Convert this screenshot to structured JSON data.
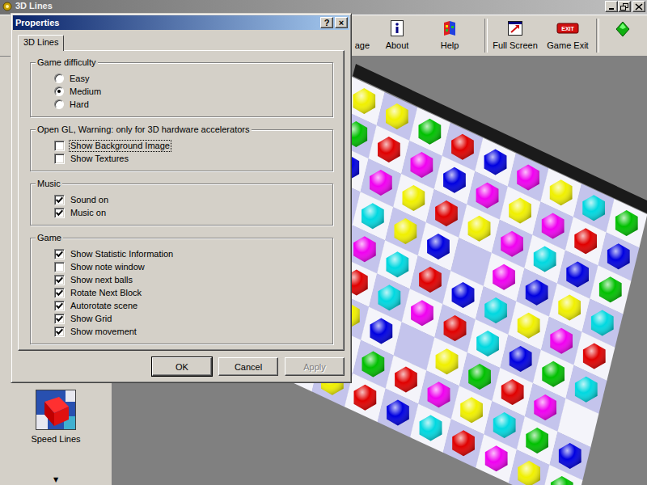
{
  "main_window": {
    "title": "3D Lines"
  },
  "toolbar": [
    {
      "label": "age",
      "kind": "partial",
      "separator_after": false
    },
    {
      "label": "About",
      "kind": "about",
      "separator_after": false
    },
    {
      "label": "Help",
      "kind": "help",
      "separator_after": true
    },
    {
      "label": "Full Screen",
      "kind": "fullscreen",
      "separator_after": false
    },
    {
      "label": "Game Exit",
      "kind": "exit",
      "icon_text": "EXIT",
      "separator_after": true
    }
  ],
  "sidebar": {
    "items": [
      {
        "label": "Speed Lines"
      }
    ],
    "scroll_icon": "▼"
  },
  "dialog": {
    "title": "Properties",
    "title_buttons": [
      "?",
      "×"
    ],
    "tabs": [
      {
        "label": "3D Lines",
        "selected": true
      }
    ],
    "groups": [
      {
        "title": "Game difficulty",
        "options": [
          {
            "kind": "radio",
            "label": "Easy",
            "selected": false,
            "focused": false
          },
          {
            "kind": "radio",
            "label": "Medium",
            "selected": true,
            "focused": false
          },
          {
            "kind": "radio",
            "label": "Hard",
            "selected": false,
            "focused": false
          }
        ]
      },
      {
        "title": "Open GL, Warning: only for 3D hardware accelerators",
        "options": [
          {
            "kind": "checkbox",
            "label": "Show Background Image",
            "checked": false,
            "focused": true
          },
          {
            "kind": "checkbox",
            "label": "Show Textures",
            "checked": false,
            "focused": false
          }
        ]
      },
      {
        "title": "Music",
        "options": [
          {
            "kind": "checkbox",
            "label": "Sound on",
            "checked": true,
            "focused": false
          },
          {
            "kind": "checkbox",
            "label": "Music on",
            "checked": true,
            "focused": false
          }
        ]
      },
      {
        "title": "Game",
        "options": [
          {
            "kind": "checkbox",
            "label": "Show Statistic Information",
            "checked": true,
            "focused": false
          },
          {
            "kind": "checkbox",
            "label": "Show note window",
            "checked": false,
            "focused": false
          },
          {
            "kind": "checkbox",
            "label": "Show next balls",
            "checked": true,
            "focused": false
          },
          {
            "kind": "checkbox",
            "label": "Rotate Next Block",
            "checked": true,
            "focused": false
          },
          {
            "kind": "checkbox",
            "label": "Autorotate scene",
            "checked": true,
            "focused": false
          },
          {
            "kind": "checkbox",
            "label": "Show Grid",
            "checked": true,
            "focused": false
          },
          {
            "kind": "checkbox",
            "label": "Show movement",
            "checked": true,
            "focused": false
          }
        ]
      }
    ],
    "buttons": [
      {
        "label": "OK",
        "disabled": false,
        "default": true
      },
      {
        "label": "Cancel",
        "disabled": false,
        "default": false
      },
      {
        "label": "Apply",
        "disabled": true,
        "default": false
      }
    ]
  },
  "board": {
    "cells": [
      [
        "#f0f000",
        "#f0f000",
        "#00c000",
        "#e00000",
        "#0000e0",
        "#f000f0",
        "#f0f000",
        "#00d8e0",
        "#00c000"
      ],
      [
        "#00c000",
        "#e00000",
        "#f000f0",
        "#0000e0",
        "#f000f0",
        "#f0f000",
        "#f000f0",
        "#e00000",
        "#0000e0"
      ],
      [
        "#0000e0",
        "#f000f0",
        "#f0f000",
        "#e00000",
        "#f0f000",
        "#f000f0",
        "#00d8e0",
        "#0000e0",
        "#00c000"
      ],
      [
        null,
        "#00d8e0",
        "#f0f000",
        "#0000e0",
        null,
        "#f000f0",
        "#0000e0",
        "#f0f000",
        "#00d8e0"
      ],
      [
        "#0000e0",
        "#f000f0",
        "#00d8e0",
        "#e00000",
        "#0000e0",
        "#00d8e0",
        "#f0f000",
        "#f000f0",
        "#e00000"
      ],
      [
        "#f0f000",
        "#e00000",
        "#00d8e0",
        "#f000f0",
        "#e00000",
        "#00d8e0",
        "#0000e0",
        "#00c000",
        "#00d8e0"
      ],
      [
        "#f000f0",
        "#f0f000",
        "#0000e0",
        null,
        "#f0f000",
        "#00c000",
        "#e00000",
        "#f000f0",
        null
      ],
      [
        "#0000e0",
        "#00d8e0",
        "#00c000",
        "#e00000",
        "#f000f0",
        "#f0f000",
        "#00d8e0",
        "#00c000",
        "#0000e0"
      ],
      [
        "#00c000",
        "#f0f000",
        "#e00000",
        "#0000e0",
        "#00d8e0",
        "#e00000",
        "#f000f0",
        "#f0f000",
        "#00c000"
      ]
    ]
  }
}
